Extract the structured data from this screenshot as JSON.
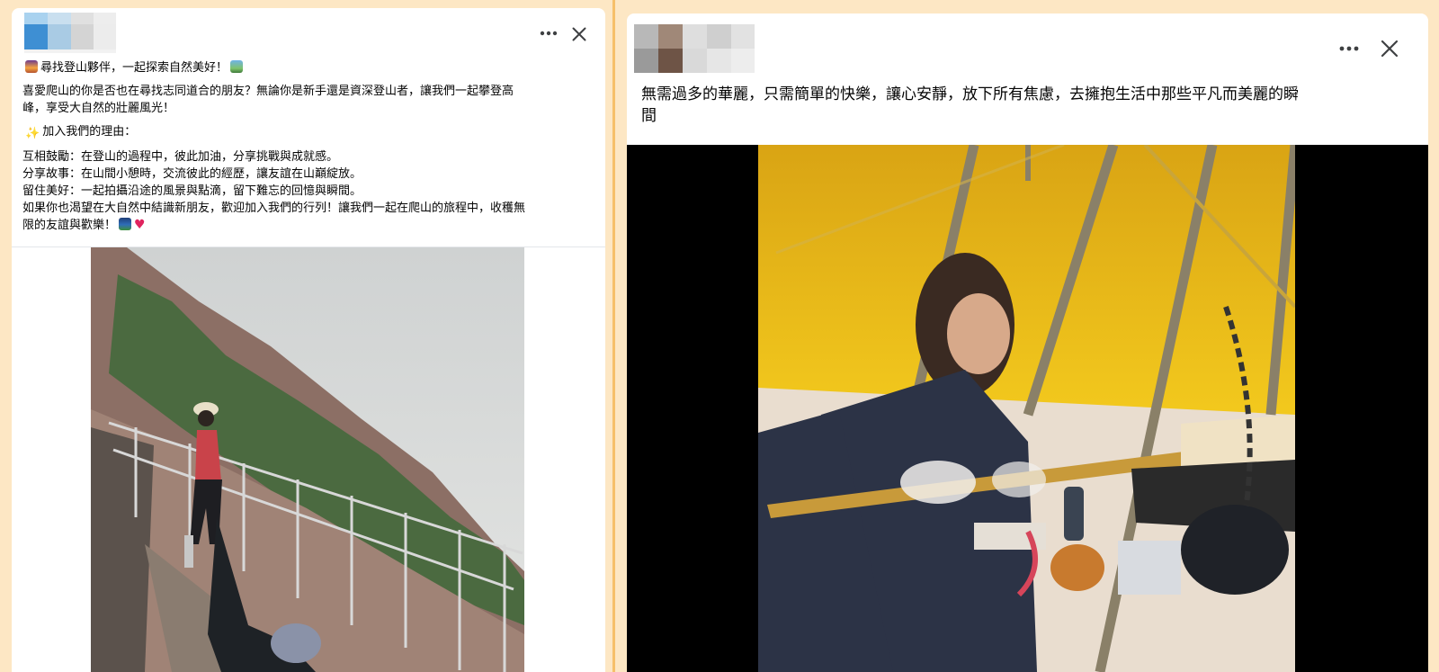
{
  "colors": {
    "page_bg": "#fde7c4",
    "divider": "#f6c06a",
    "card_bg": "#ffffff",
    "text": "#050505",
    "icon": "#3e4042",
    "photo_letterbox": "#000000"
  },
  "left_post": {
    "more_icon": "more-options-icon",
    "close_icon": "close-icon",
    "title_line": "尋找登山夥伴，一起探索自然美好！",
    "intro_line1": "喜愛爬山的你是否也在尋找志同道合的朋友？無論你是新手還是資深登山者，讓我們一起攀登高",
    "intro_line2": "峰，享受大自然的壯麗風光！",
    "reasons_heading": "加入我們的理由：",
    "reason1": "互相鼓勵：在登山的過程中，彼此加油，分享挑戰與成就感。",
    "reason2": "分享故事：在山間小憩時，交流彼此的經歷，讓友誼在山巔綻放。",
    "reason3": "留住美好：一起拍攝沿途的風景與點滴，留下難忘的回憶與瞬間。",
    "closing_line1": "如果你也渴望在大自然中結識新朋友，歡迎加入我們的行列！讓我們一起在爬山的旅程中，收穫無",
    "closing_line2": "限的友誼與歡樂！",
    "emoji_icons": [
      "sunrise-mountain-icon",
      "landscape-photo-icon",
      "sparkles-icon",
      "mountain-night-icon",
      "red-heart-icon"
    ]
  },
  "right_post": {
    "more_icon": "more-options-icon",
    "close_icon": "close-icon",
    "caption_line1": "無需過多的華麗，只需簡單的快樂，讓心安靜，放下所有焦慮，去擁抱生活中那些平凡而美麗的瞬",
    "caption_line2": "間"
  }
}
